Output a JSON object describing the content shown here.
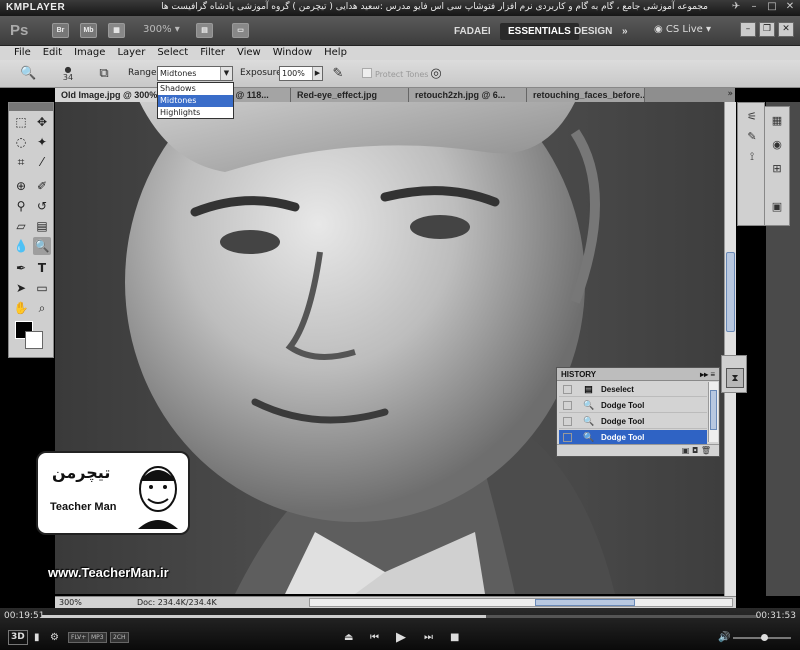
{
  "player": {
    "logo": "KMPLAYER",
    "title": "مجموعه آموزشی جامع ، گام به گام و کاربردی نرم افزار فتوشاپ سی اس فایو مدرس :سعید هدایی ( تیچرمن ) گروه آموزشی پادشاه گرافیست ها",
    "time_elapsed": "00:19:51",
    "time_total": "00:31:53",
    "progress_percent": 62,
    "volume_percent": 55,
    "badges": [
      "FLV+",
      "MP3",
      "2CH"
    ],
    "mode_label": "3D"
  },
  "appbar": {
    "logo": "Ps",
    "bridge_label": "Br",
    "minibridge_label": "Mb",
    "zoom": "300%",
    "workspaces": [
      "FADAEI",
      "ESSENTIALS",
      "DESIGN"
    ],
    "active_workspace": "ESSENTIALS",
    "cs_live": "CS Live"
  },
  "menu": [
    "File",
    "Edit",
    "Image",
    "Layer",
    "Select",
    "Filter",
    "View",
    "Window",
    "Help"
  ],
  "options": {
    "brush_size": "34",
    "range_label": "Range:",
    "range_value": "Midtones",
    "range_options": [
      "Shadows",
      "Midtones",
      "Highlights"
    ],
    "exposure_label": "Exposure:",
    "exposure_value": "100%",
    "protect_tones": "Protect Tones"
  },
  "tabs": [
    "Old Image.jpg @ 300%",
    "retouch2.jpg @ 118...",
    "Red-eye_effect.jpg",
    "retouch2zh.jpg @ 6...",
    "retouching_faces_before..."
  ],
  "status": {
    "zoom": "300%",
    "doc": "Doc: 234.4K/234.4K"
  },
  "history": {
    "title": "HISTORY",
    "items": [
      "Deselect",
      "Dodge Tool",
      "Dodge Tool",
      "Dodge Tool"
    ],
    "selected_index": 3
  },
  "watermark": {
    "persian_name": "تیچرمن",
    "english_name": "Teacher Man",
    "url": "www.TeacherMan.ir"
  }
}
